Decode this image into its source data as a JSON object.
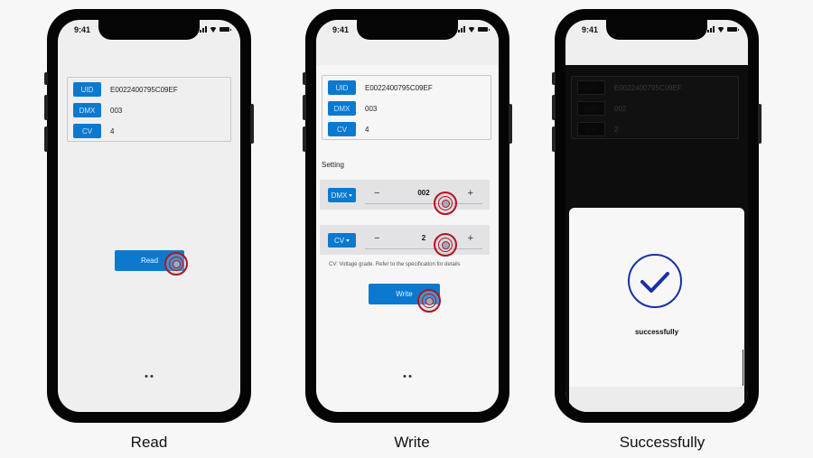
{
  "phones": {
    "read": {
      "status_time": "9:41",
      "info": [
        {
          "tag": "UID",
          "value": "E0022400795C09EF"
        },
        {
          "tag": "DMX",
          "value": "003"
        },
        {
          "tag": "CV",
          "value": "4"
        }
      ],
      "read_button": "Read",
      "caption": "Read"
    },
    "write": {
      "status_time": "9:41",
      "info": [
        {
          "tag": "UID",
          "value": "E0022400795C09EF"
        },
        {
          "tag": "DMX",
          "value": "003"
        },
        {
          "tag": "CV",
          "value": "4"
        }
      ],
      "setting_label": "Setting",
      "dmx_setting": {
        "select": "DMX",
        "minus": "−",
        "value": "002",
        "plus": "+"
      },
      "cv_setting": {
        "select": "CV",
        "minus": "−",
        "value": "2",
        "plus": "+"
      },
      "hint": "CV: Voltage grade. Refer to the specification for details",
      "write_button": "Write",
      "caption": "Write"
    },
    "success": {
      "status_time": "9:41",
      "info": [
        {
          "tag": "UID",
          "value": "E0022400795C09EF"
        },
        {
          "tag": "DMX",
          "value": "002"
        },
        {
          "tag": "CV",
          "value": "2"
        }
      ],
      "modal_text": "successfully",
      "caption": "Successfully"
    }
  },
  "colors": {
    "accent": "#0b79cf",
    "check": "#1a2fa8",
    "tap_ring": "#b3141c"
  }
}
